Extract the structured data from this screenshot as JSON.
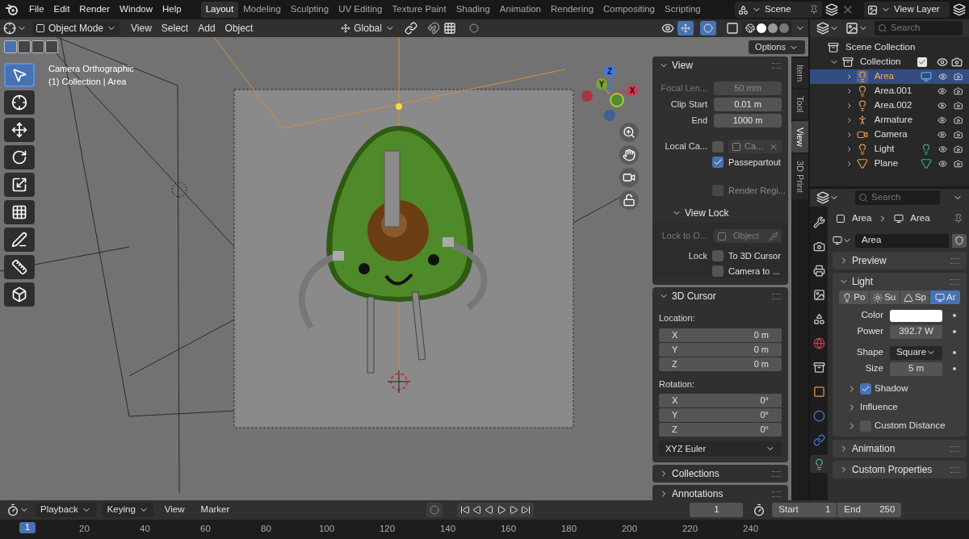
{
  "menu": [
    "File",
    "Edit",
    "Render",
    "Window",
    "Help"
  ],
  "workspaces": [
    {
      "label": "Layout",
      "selected": true
    },
    {
      "label": "Modeling",
      "selected": false
    },
    {
      "label": "Sculpting",
      "selected": false
    },
    {
      "label": "UV Editing",
      "selected": false
    },
    {
      "label": "Texture Paint",
      "selected": false
    },
    {
      "label": "Shading",
      "selected": false
    },
    {
      "label": "Animation",
      "selected": false
    },
    {
      "label": "Rendering",
      "selected": false
    },
    {
      "label": "Compositing",
      "selected": false
    },
    {
      "label": "Scripting",
      "selected": false
    }
  ],
  "scene": "Scene",
  "view_layer": "View Layer",
  "viewport_header": {
    "mode": "Object Mode",
    "menus": [
      "View",
      "Select",
      "Add",
      "Object"
    ],
    "orientation": "Global"
  },
  "viewport": {
    "options": "Options",
    "info": [
      "Camera Orthographic",
      "(1) Collection | Area"
    ],
    "axes": [
      "Z",
      "Y",
      "X"
    ]
  },
  "sidebar": {
    "tabs": [
      {
        "label": "Item",
        "selected": false
      },
      {
        "label": "Tool",
        "selected": false
      },
      {
        "label": "View",
        "selected": true
      },
      {
        "label": "3D Print",
        "selected": false
      }
    ],
    "view_panel": {
      "title": "View",
      "expanded": true,
      "rows": [
        {
          "kind": "field",
          "label": "Focal Len...",
          "value": "50 mm",
          "disabled": true
        },
        {
          "kind": "field",
          "label": "Clip Start",
          "value": "0.01 m",
          "disabled": false
        },
        {
          "kind": "field",
          "label": "End",
          "value": "1000 m",
          "disabled": false
        },
        {
          "kind": "camera",
          "label": "Local Ca...",
          "value": "Ca...",
          "checked": false,
          "disabled": true
        },
        {
          "kind": "check",
          "label": "Passepartout",
          "checked": true,
          "disabled": false
        },
        {
          "kind": "check",
          "label": "Render Regi...",
          "checked": false,
          "disabled": true
        }
      ],
      "lock": {
        "title": "View Lock",
        "expanded": true,
        "rows": [
          {
            "kind": "object",
            "label": "Lock to O...",
            "value": "Object",
            "disabled": true
          },
          {
            "kind": "check",
            "caption": "Lock",
            "label": "To 3D Cursor",
            "checked": false,
            "disabled": false
          },
          {
            "kind": "check",
            "label": "Camera to ...",
            "checked": false,
            "disabled": false
          }
        ]
      }
    },
    "cursor_panel": {
      "title": "3D Cursor",
      "expanded": true,
      "location_label": "Location:",
      "location": [
        {
          "axis": "X",
          "value": "0 m"
        },
        {
          "axis": "Y",
          "value": "0 m"
        },
        {
          "axis": "Z",
          "value": "0 m"
        }
      ],
      "rotation_label": "Rotation:",
      "rotation": [
        {
          "axis": "X",
          "value": "0°"
        },
        {
          "axis": "Y",
          "value": "0°"
        },
        {
          "axis": "Z",
          "value": "0°"
        }
      ],
      "rotation_mode": "XYZ Euler"
    },
    "more_panels": [
      {
        "title": "Collections",
        "expanded": false
      },
      {
        "title": "Annotations",
        "expanded": false
      }
    ]
  },
  "outliner": {
    "search_placeholder": "Search",
    "root": "Scene Collection",
    "collection": {
      "label": "Collection",
      "checked": true,
      "expanded": true,
      "items": [
        {
          "label": "Area",
          "kind": "light",
          "data": {
            "kind": "area"
          },
          "selected": true
        },
        {
          "label": "Area.001",
          "kind": "light",
          "selected": false
        },
        {
          "label": "Area.002",
          "kind": "light",
          "selected": false
        },
        {
          "label": "Armature",
          "kind": "armature",
          "selected": false
        },
        {
          "label": "Camera",
          "kind": "camera",
          "selected": false
        },
        {
          "label": "Light",
          "kind": "light",
          "data": {
            "kind": "point"
          },
          "selected": false
        },
        {
          "label": "Plane",
          "kind": "mesh",
          "data": {
            "kind": "mesh"
          },
          "selected": false
        }
      ]
    }
  },
  "properties": {
    "search_placeholder": "Search",
    "tabs": [
      {
        "kind": "tool",
        "selected": false
      },
      {
        "kind": "render",
        "selected": false
      },
      {
        "kind": "output",
        "selected": false
      },
      {
        "kind": "view_layer",
        "selected": false
      },
      {
        "kind": "scene",
        "selected": false
      },
      {
        "kind": "world",
        "selected": false
      },
      {
        "kind": "collection",
        "selected": false
      },
      {
        "kind": "object",
        "selected": false
      },
      {
        "kind": "physics",
        "selected": false
      },
      {
        "kind": "constraints",
        "selected": false
      },
      {
        "kind": "data",
        "selected": true
      }
    ],
    "breadcrumb": [
      "Area",
      "Area"
    ],
    "datablock": "Area",
    "preview": {
      "title": "Preview",
      "expanded": false
    },
    "light": {
      "title": "Light",
      "expanded": true,
      "types": [
        {
          "label": "Po",
          "kind": "point",
          "selected": false
        },
        {
          "label": "Su",
          "kind": "sun",
          "selected": false
        },
        {
          "label": "Sp",
          "kind": "spot",
          "selected": false
        },
        {
          "label": "Ar",
          "kind": "area",
          "selected": true
        }
      ],
      "rows": [
        {
          "kind": "color",
          "label": "Color"
        },
        {
          "kind": "number",
          "label": "Power",
          "value": "392.7 W"
        },
        {
          "kind": "dropdown",
          "label": "Shape",
          "value": "Square"
        },
        {
          "kind": "number",
          "label": "Size",
          "value": "5 m"
        }
      ],
      "subpanels": [
        {
          "title": "Shadow",
          "expanded": false,
          "kind": "check",
          "checked": true
        },
        {
          "title": "Influence",
          "expanded": false,
          "kind": "plain"
        },
        {
          "title": "Custom Distance",
          "expanded": false,
          "kind": "check",
          "checked": false
        }
      ]
    },
    "more_panels": [
      {
        "title": "Animation",
        "expanded": false
      },
      {
        "title": "Custom Properties",
        "expanded": false
      }
    ]
  },
  "timeline": {
    "menus": [
      {
        "label": "Playback",
        "dropdown": true
      },
      {
        "label": "Keying",
        "dropdown": true
      },
      {
        "label": "View",
        "dropdown": false
      },
      {
        "label": "Marker",
        "dropdown": false
      }
    ],
    "frame": "1",
    "start_label": "Start",
    "start": "1",
    "end_label": "End",
    "end": "250",
    "current": "1",
    "ticks": [
      "20",
      "40",
      "60",
      "80",
      "100",
      "120",
      "140",
      "160",
      "180",
      "200",
      "220",
      "240"
    ]
  }
}
